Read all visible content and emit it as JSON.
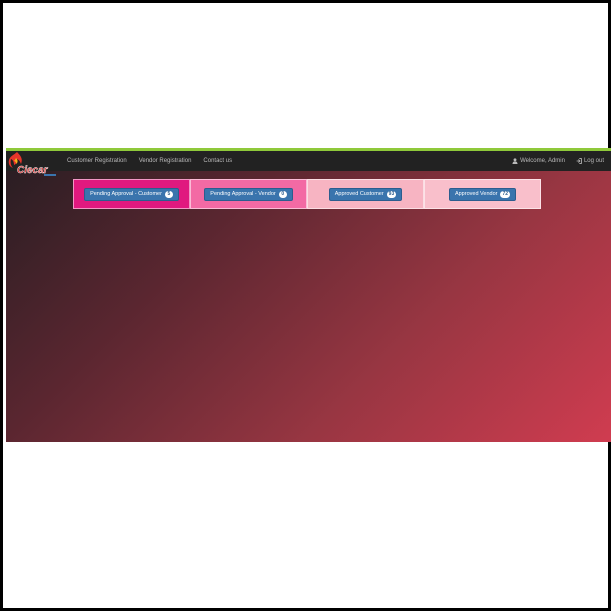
{
  "navbar": {
    "links": [
      {
        "label": "Customer Registration"
      },
      {
        "label": "Vendor Registration"
      },
      {
        "label": "Contact us"
      }
    ],
    "welcome": "Welcome, Admin",
    "logout": "Log out"
  },
  "tiles": [
    {
      "label": "Pending Approval - Customer",
      "count": "5",
      "color": "#e0197f"
    },
    {
      "label": "Pending Approval - Vendor",
      "count": "0",
      "color": "#f36aa4"
    },
    {
      "label": "Approved Customer",
      "count": "93",
      "color": "#f7b4c2"
    },
    {
      "label": "Approved Vendor",
      "count": "72",
      "color": "#f9bfcb"
    }
  ],
  "colors": {
    "accent": "#8fc93a",
    "navbar": "#222222",
    "button": "#3a74ad"
  },
  "icons": {
    "user": "user-icon",
    "logout": "logout-icon",
    "logo": "brand-logo"
  }
}
